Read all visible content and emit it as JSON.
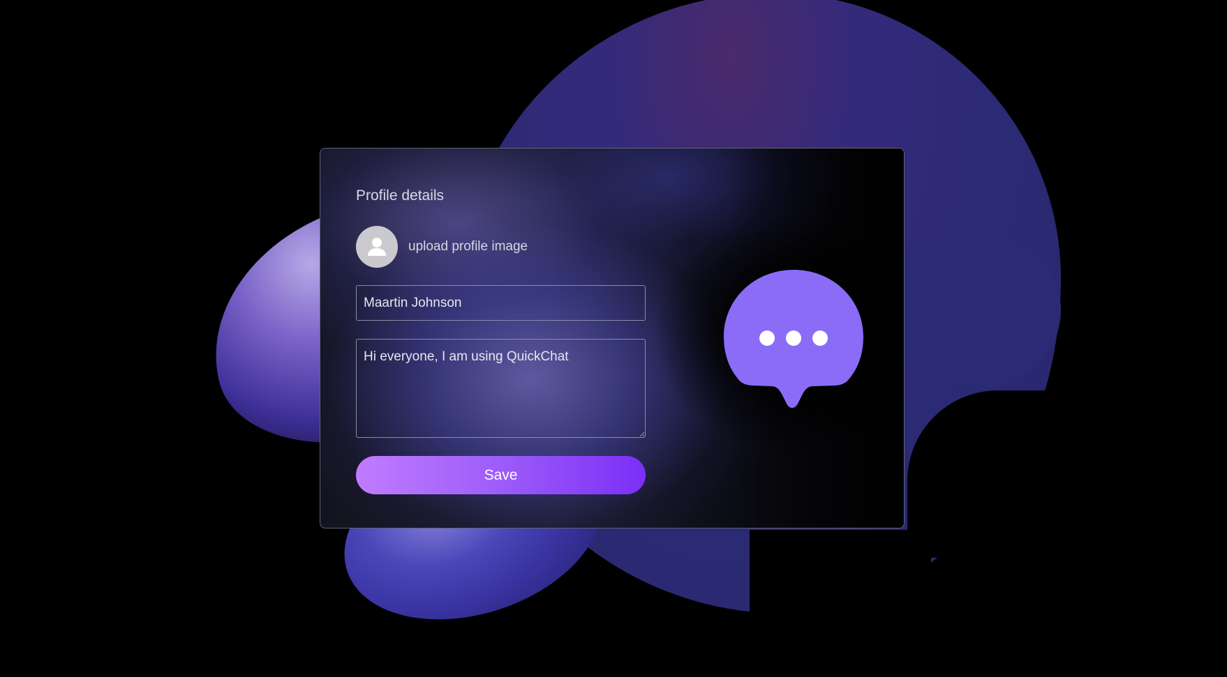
{
  "profile_card": {
    "title": "Profile details",
    "upload_label": "upload profile image",
    "avatar_icon": "user-silhouette-icon",
    "name_value": "Maartin Johnson",
    "bio_value": "Hi everyone, I am using QuickChat",
    "save_label": "Save"
  },
  "logo": {
    "icon": "chat-bubble-ellipsis-icon"
  },
  "colors": {
    "background": "#000000",
    "accent_start": "#c07cff",
    "accent_end": "#7b2ff7",
    "logo": "#8b6cf7",
    "blob": "#2b2a74"
  }
}
